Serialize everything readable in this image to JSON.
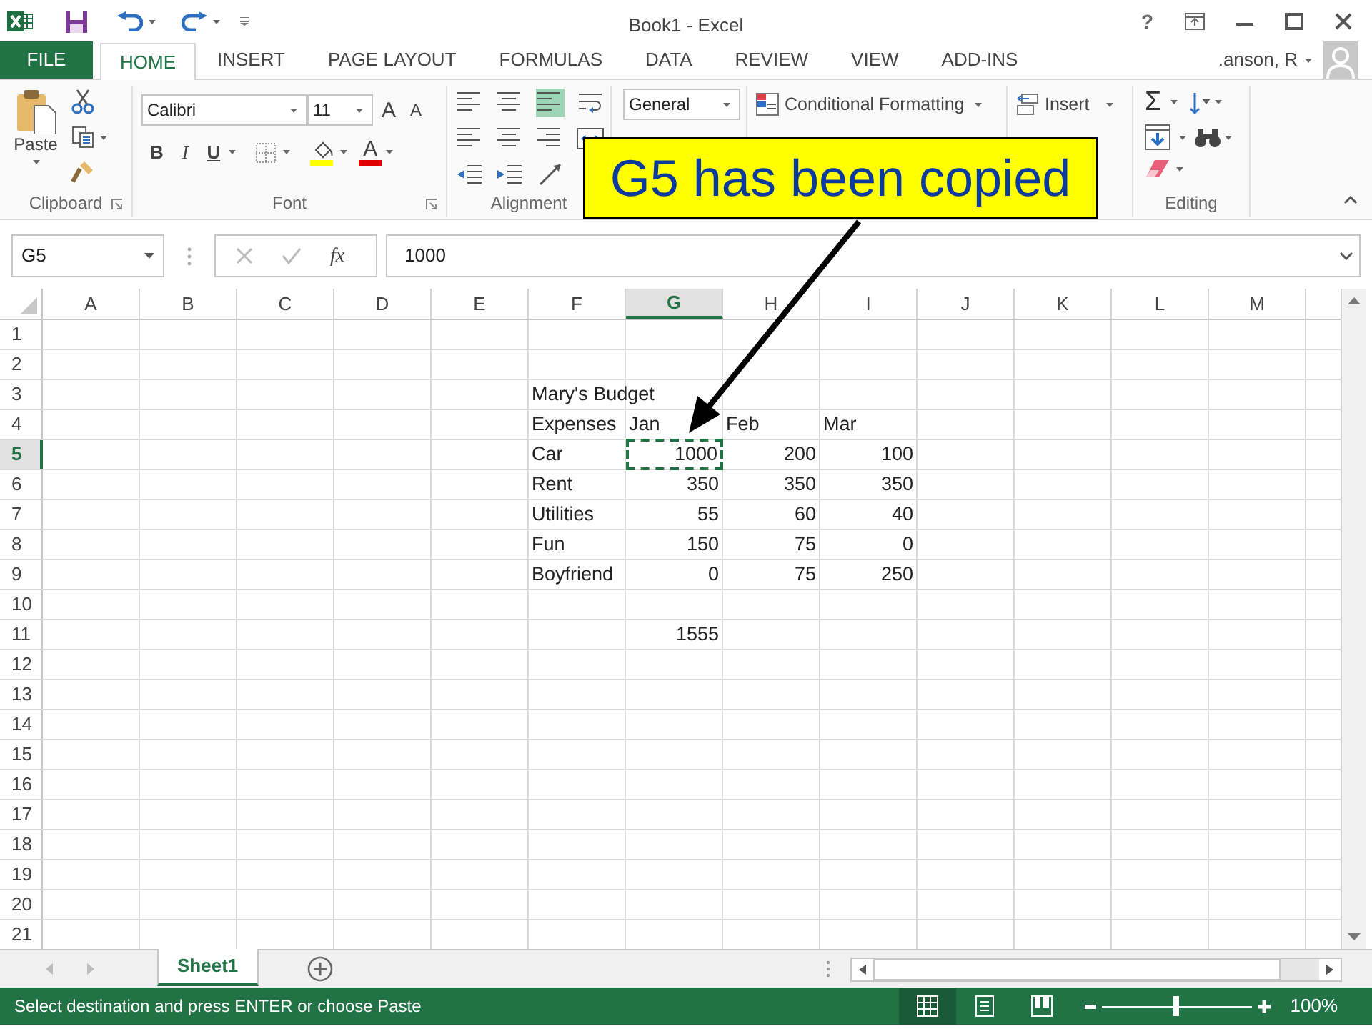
{
  "window": {
    "title": "Book1 - Excel",
    "help": "?"
  },
  "file_menu": "FILE",
  "tabs": [
    {
      "label": "HOME",
      "selected": true
    },
    {
      "label": "INSERT",
      "selected": false
    },
    {
      "label": "PAGE LAYOUT",
      "selected": false
    },
    {
      "label": "FORMULAS",
      "selected": false
    },
    {
      "label": "DATA",
      "selected": false
    },
    {
      "label": "REVIEW",
      "selected": false
    },
    {
      "label": "VIEW",
      "selected": false
    },
    {
      "label": "ADD-INS",
      "selected": false
    }
  ],
  "account": {
    "name": ".anson, R"
  },
  "ribbon": {
    "clipboard": {
      "label": "Clipboard",
      "paste": "Paste"
    },
    "font": {
      "label": "Font",
      "name": "Calibri",
      "size": "11",
      "grow": "A",
      "shrink": "A",
      "bold": "B",
      "italic": "I",
      "underline": "U",
      "font_color_label": "A"
    },
    "alignment": {
      "label": "Alignment"
    },
    "number": {
      "format": "General"
    },
    "styles": {
      "conditional_formatting": "Conditional Formatting"
    },
    "cells": {
      "insert": "Insert"
    },
    "editing": {
      "label": "Editing",
      "autosum": "Σ"
    }
  },
  "formula_bar": {
    "name_box": "G5",
    "function_label": "fx",
    "value": "1000"
  },
  "sheet": {
    "columns": [
      {
        "label": "A",
        "selected": false
      },
      {
        "label": "B",
        "selected": false
      },
      {
        "label": "C",
        "selected": false
      },
      {
        "label": "D",
        "selected": false
      },
      {
        "label": "E",
        "selected": false
      },
      {
        "label": "F",
        "selected": false
      },
      {
        "label": "G",
        "selected": true
      },
      {
        "label": "H",
        "selected": false
      },
      {
        "label": "I",
        "selected": false
      },
      {
        "label": "J",
        "selected": false
      },
      {
        "label": "K",
        "selected": false
      },
      {
        "label": "L",
        "selected": false
      },
      {
        "label": "M",
        "selected": false
      }
    ],
    "rows": [
      {
        "label": "1",
        "selected": false
      },
      {
        "label": "2",
        "selected": false
      },
      {
        "label": "3",
        "selected": false,
        "cells": {
          "F": {
            "text": "Mary's Budget",
            "kind": "text",
            "copied": false
          }
        }
      },
      {
        "label": "4",
        "selected": false,
        "cells": {
          "F": {
            "text": "Expenses",
            "kind": "text",
            "copied": false
          },
          "G": {
            "text": "Jan",
            "kind": "text",
            "copied": false
          },
          "H": {
            "text": "Feb",
            "kind": "text",
            "copied": false
          },
          "I": {
            "text": "Mar",
            "kind": "text",
            "copied": false
          }
        }
      },
      {
        "label": "5",
        "selected": true,
        "cells": {
          "F": {
            "text": "Car",
            "kind": "text",
            "copied": false
          },
          "G": {
            "text": "1000",
            "kind": "number",
            "copied": true
          },
          "H": {
            "text": "200",
            "kind": "number",
            "copied": false
          },
          "I": {
            "text": "100",
            "kind": "number",
            "copied": false
          }
        }
      },
      {
        "label": "6",
        "selected": false,
        "cells": {
          "F": {
            "text": "Rent",
            "kind": "text",
            "copied": false
          },
          "G": {
            "text": "350",
            "kind": "number",
            "copied": false
          },
          "H": {
            "text": "350",
            "kind": "number",
            "copied": false
          },
          "I": {
            "text": "350",
            "kind": "number",
            "copied": false
          }
        }
      },
      {
        "label": "7",
        "selected": false,
        "cells": {
          "F": {
            "text": "Utilities",
            "kind": "text",
            "copied": false
          },
          "G": {
            "text": "55",
            "kind": "number",
            "copied": false
          },
          "H": {
            "text": "60",
            "kind": "number",
            "copied": false
          },
          "I": {
            "text": "40",
            "kind": "number",
            "copied": false
          }
        }
      },
      {
        "label": "8",
        "selected": false,
        "cells": {
          "F": {
            "text": "Fun",
            "kind": "text",
            "copied": false
          },
          "G": {
            "text": "150",
            "kind": "number",
            "copied": false
          },
          "H": {
            "text": "75",
            "kind": "number",
            "copied": false
          },
          "I": {
            "text": "0",
            "kind": "number",
            "copied": false
          }
        }
      },
      {
        "label": "9",
        "selected": false,
        "cells": {
          "F": {
            "text": "Boyfriend",
            "kind": "text",
            "copied": false
          },
          "G": {
            "text": "0",
            "kind": "number",
            "copied": false
          },
          "H": {
            "text": "75",
            "kind": "number",
            "copied": false
          },
          "I": {
            "text": "250",
            "kind": "number",
            "copied": false
          }
        }
      },
      {
        "label": "10",
        "selected": false
      },
      {
        "label": "11",
        "selected": false,
        "cells": {
          "G": {
            "text": "1555",
            "kind": "number",
            "copied": false
          }
        }
      },
      {
        "label": "12",
        "selected": false
      },
      {
        "label": "13",
        "selected": false
      },
      {
        "label": "14",
        "selected": false
      },
      {
        "label": "15",
        "selected": false
      },
      {
        "label": "16",
        "selected": false
      },
      {
        "label": "17",
        "selected": false
      },
      {
        "label": "18",
        "selected": false
      },
      {
        "label": "19",
        "selected": false
      },
      {
        "label": "20",
        "selected": false
      },
      {
        "label": "21",
        "selected": false
      }
    ]
  },
  "sheet_tabs": [
    {
      "label": "Sheet1",
      "selected": true
    }
  ],
  "status_bar": {
    "message": "Select destination and press ENTER or choose Paste",
    "views": [
      {
        "kind": "normal",
        "selected": true
      },
      {
        "kind": "page_layout",
        "selected": false
      },
      {
        "kind": "page_break",
        "selected": false
      }
    ],
    "zoom": {
      "level": 0.5,
      "reading": "100%"
    }
  },
  "callout": {
    "text": "G5 has been copied"
  }
}
